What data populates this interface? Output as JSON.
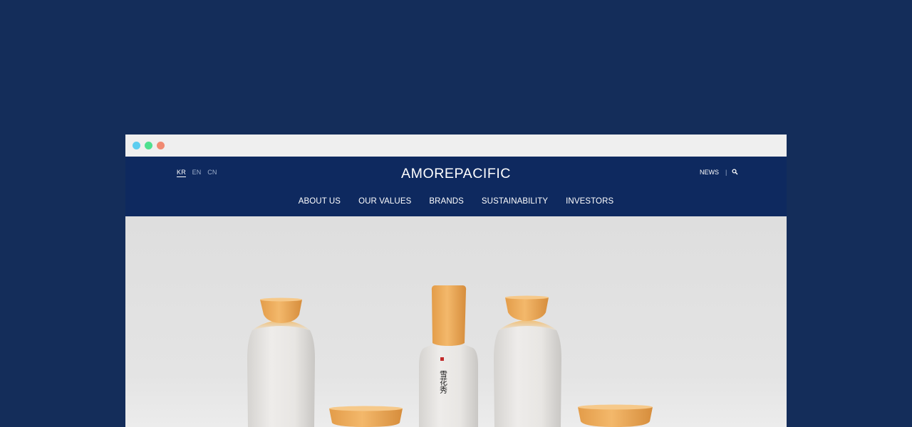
{
  "window": {
    "controls": [
      "close",
      "minimize",
      "maximize"
    ],
    "dot_colors": [
      "#5ccdf0",
      "#4ee08f",
      "#f08a72"
    ]
  },
  "header": {
    "background": "#0e295f",
    "brand_logo": {
      "left": "AMO",
      "mid": "RE",
      "right": "PACIFIC"
    },
    "languages": [
      {
        "code": "KR",
        "active": true
      },
      {
        "code": "EN",
        "active": false
      },
      {
        "code": "CN",
        "active": false
      }
    ],
    "utility": {
      "news_label": "NEWS",
      "separator": "|",
      "search_icon": "search-icon"
    },
    "nav": [
      {
        "label": "ABOUT US"
      },
      {
        "label": "OUR VALUES"
      },
      {
        "label": "BRANDS"
      },
      {
        "label": "SUSTAINABILITY"
      },
      {
        "label": "INVESTORS"
      }
    ]
  },
  "hero": {
    "image": "product-bottles-image",
    "product_label_glyphs": "雪花秀",
    "colors": {
      "bottle": "#e7e5e2",
      "cap": "#eeb060",
      "backdrop": "#e1e1e1"
    }
  }
}
